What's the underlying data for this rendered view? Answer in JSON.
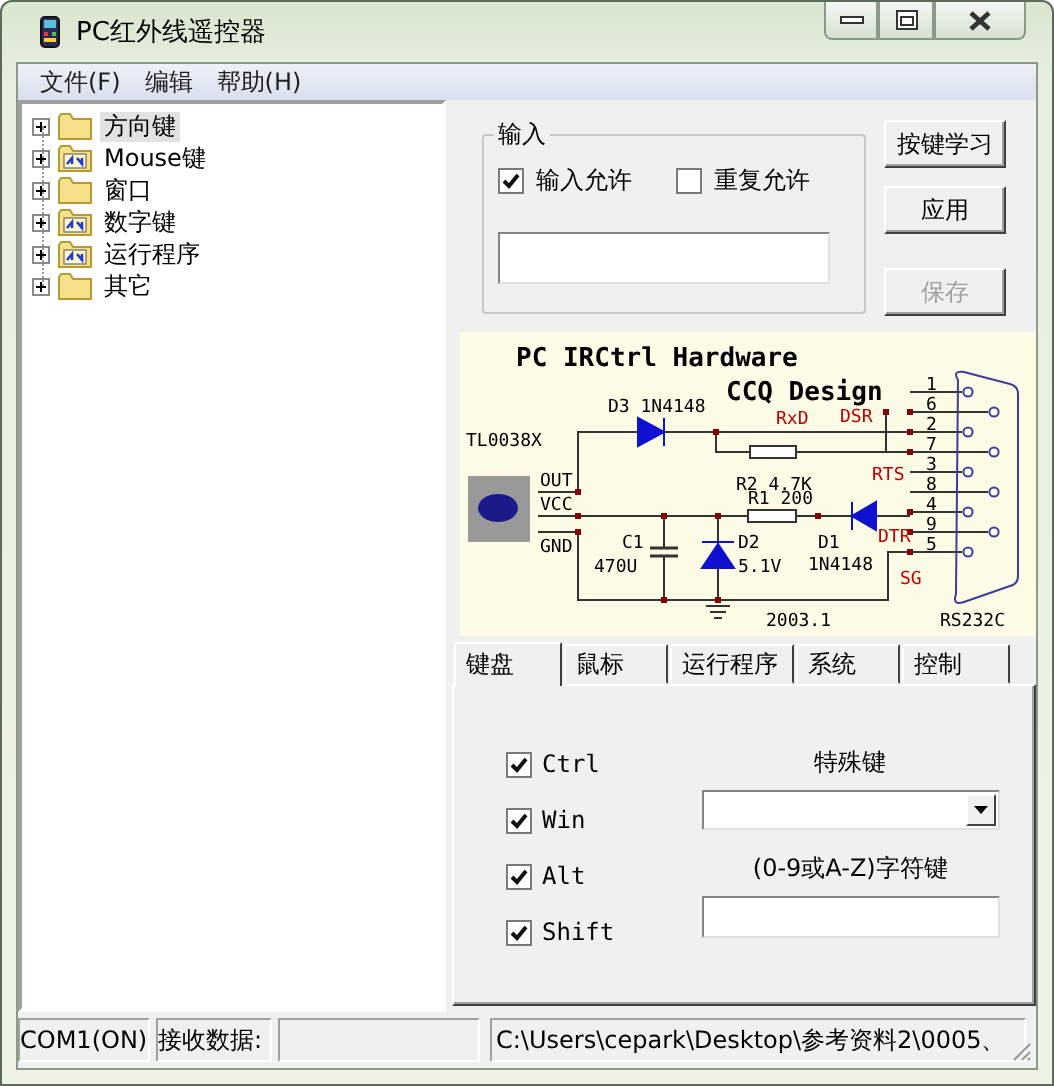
{
  "window": {
    "title": "PC红外线遥控器"
  },
  "menu": [
    "文件(F)",
    "编辑",
    "帮助(H)"
  ],
  "tree": {
    "items": [
      {
        "label": "方向键",
        "kind": "folder",
        "expanded": false,
        "selected": true
      },
      {
        "label": "Mouse键",
        "kind": "linked",
        "expanded": false,
        "selected": false
      },
      {
        "label": "窗口",
        "kind": "folder",
        "expanded": false,
        "selected": false
      },
      {
        "label": "数字键",
        "kind": "linked",
        "expanded": false,
        "selected": false
      },
      {
        "label": "运行程序",
        "kind": "linked",
        "expanded": false,
        "selected": false
      },
      {
        "label": "其它",
        "kind": "folder",
        "expanded": false,
        "selected": false
      }
    ]
  },
  "input_group": {
    "title": "输入",
    "checkboxes": [
      {
        "label": "输入允许",
        "checked": true
      },
      {
        "label": "重复允许",
        "checked": false
      }
    ]
  },
  "buttons": [
    {
      "label": "按键学习",
      "disabled": false
    },
    {
      "label": "应用",
      "disabled": false
    },
    {
      "label": "保存",
      "disabled": true
    }
  ],
  "schematic": {
    "labels": [
      {
        "text": "PC IRCtrl Hardware",
        "kind": "title"
      },
      {
        "text": "CCQ Design",
        "kind": "title"
      },
      {
        "text": "D3 1N4148",
        "kind": "part"
      },
      {
        "text": "RxD",
        "kind": "signal"
      },
      {
        "text": "DSR",
        "kind": "signal"
      },
      {
        "text": "TL0038X",
        "kind": "part"
      },
      {
        "text": "R2 4.7K",
        "kind": "part"
      },
      {
        "text": "RTS",
        "kind": "signal"
      },
      {
        "text": "OUT",
        "kind": "part"
      },
      {
        "text": "VCC",
        "kind": "part"
      },
      {
        "text": "GND",
        "kind": "part"
      },
      {
        "text": "R1 200",
        "kind": "part"
      },
      {
        "text": "C1",
        "kind": "part"
      },
      {
        "text": "470U",
        "kind": "part"
      },
      {
        "text": "D2",
        "kind": "part"
      },
      {
        "text": "5.1V",
        "kind": "part"
      },
      {
        "text": "D1",
        "kind": "part"
      },
      {
        "text": "1N4148",
        "kind": "part"
      },
      {
        "text": "DTR",
        "kind": "signal"
      },
      {
        "text": "SG",
        "kind": "signal"
      },
      {
        "text": "2003.1",
        "kind": "part"
      },
      {
        "text": "RS232C",
        "kind": "part"
      }
    ],
    "pins": [
      "1",
      "6",
      "2",
      "7",
      "3",
      "8",
      "4",
      "9",
      "5"
    ]
  },
  "tabs": [
    {
      "label": "键盘",
      "selected": true
    },
    {
      "label": "鼠标",
      "selected": false
    },
    {
      "label": "运行程序",
      "selected": false
    },
    {
      "label": "系统",
      "selected": false
    },
    {
      "label": "控制",
      "selected": false
    }
  ],
  "keyboard": {
    "modifiers": [
      {
        "label": "Ctrl",
        "checked": true
      },
      {
        "label": "Win",
        "checked": true
      },
      {
        "label": "Alt",
        "checked": true
      },
      {
        "label": "Shift",
        "checked": true
      }
    ],
    "special_label": "特殊键",
    "char_label": "(0-9或A-Z)字符键"
  },
  "status_bar": {
    "port": "COM1(ON)",
    "receive_label": "接收数据:",
    "path": "C:\\Users\\cepark\\Desktop\\参考资料2\\0005、"
  }
}
